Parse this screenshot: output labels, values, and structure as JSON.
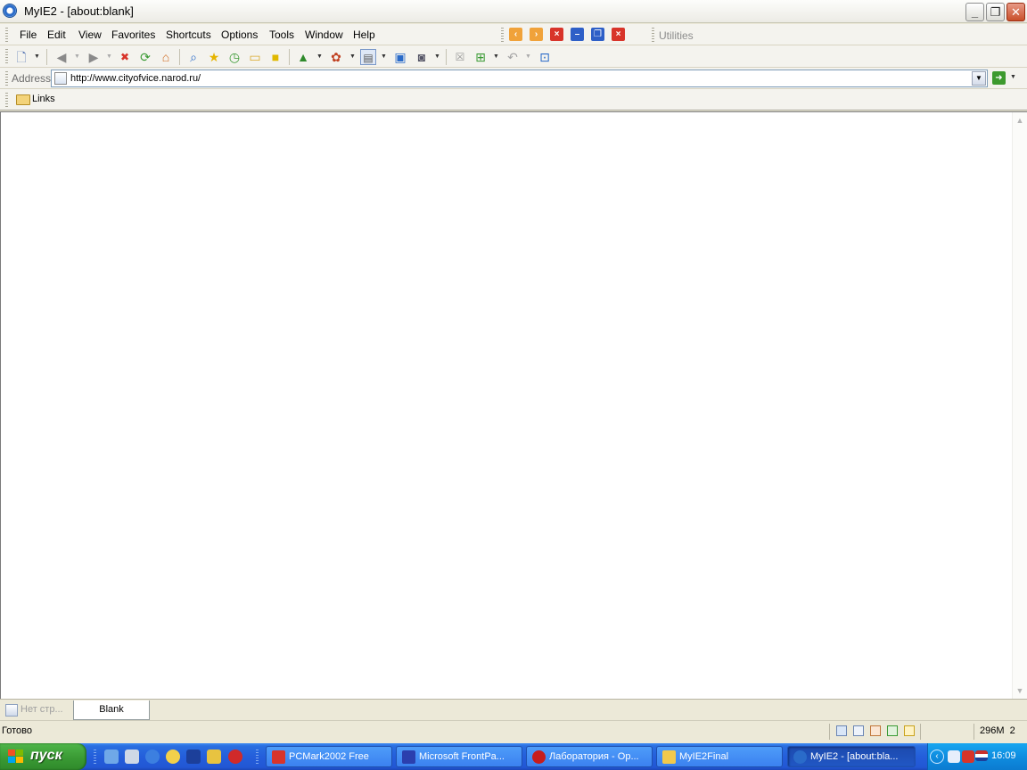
{
  "window": {
    "title": "MyIE2 - [about:blank]",
    "controls": {
      "minimize": "_",
      "restore": "❐",
      "close": "✕"
    }
  },
  "menu": {
    "items": [
      "File",
      "Edit",
      "View",
      "Favorites",
      "Shortcuts",
      "Options",
      "Tools",
      "Window",
      "Help"
    ],
    "nav_buttons": [
      "prev-window-icon",
      "next-window-icon",
      "close-window-icon",
      "minimize-window-icon",
      "restore-window-icon",
      "close-all-icon"
    ],
    "utilities_label": "Utilities"
  },
  "toolbar": {
    "buttons": [
      "new-icon",
      "back-icon",
      "forward-icon",
      "stop-icon",
      "refresh-icon",
      "home-icon",
      "search-icon",
      "favorites-icon",
      "history-icon",
      "open-folder-icon",
      "notes-icon",
      "tree-icon",
      "plugin-icon",
      "page-icon",
      "popup-icon",
      "proxy-icon",
      "close-tab-icon",
      "add-tab-icon",
      "undo-close-icon",
      "auto-save-icon"
    ]
  },
  "address": {
    "label": "Address",
    "value": "http://www.cityofvice.narod.ru/"
  },
  "links": {
    "label": "Links"
  },
  "tabs": [
    {
      "label": "Нет стр...",
      "active": false
    },
    {
      "label": "Blank",
      "active": true
    }
  ],
  "status": {
    "text": "Готово",
    "memory": "296M",
    "count": "2"
  },
  "taskbar": {
    "start_label": "пуск",
    "tasks": [
      {
        "label": "PCMark2002 Free",
        "active": false,
        "color": "#d8342a"
      },
      {
        "label": "Microsoft FrontPa...",
        "active": false,
        "color": "#2b3fae"
      },
      {
        "label": "Лаборатория - Op...",
        "active": false,
        "color": "#c71d1d"
      },
      {
        "label": "MyIE2Final",
        "active": false,
        "color": "#f2c94c"
      },
      {
        "label": "MyIE2 - [about:bla...",
        "active": true,
        "color": "#2a6bc9"
      }
    ],
    "clock": "16:09"
  },
  "colors": {
    "taskbar_blue": "#245edb",
    "start_green": "#3a9a34",
    "content_bg": "#ffffff",
    "chrome_bg": "#ece9d8"
  }
}
